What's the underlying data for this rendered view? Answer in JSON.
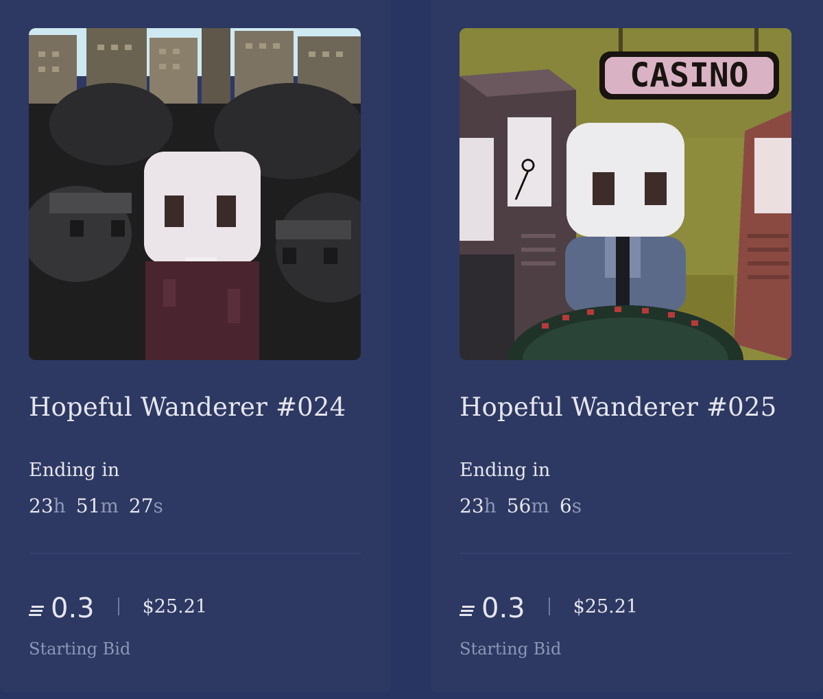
{
  "cards": [
    {
      "title": "Hopeful Wanderer #024",
      "ending_label": "Ending in",
      "countdown": {
        "hours": "23",
        "hours_unit": "h",
        "minutes": "51",
        "minutes_unit": "m",
        "seconds": "27",
        "seconds_unit": "s"
      },
      "price_eth": "0.3",
      "price_usd": "$25.21",
      "price_label": "Starting Bid",
      "icon": "eth-icon"
    },
    {
      "title": "Hopeful Wanderer #025",
      "ending_label": "Ending in",
      "countdown": {
        "hours": "23",
        "hours_unit": "h",
        "minutes": "56",
        "minutes_unit": "m",
        "seconds": "6",
        "seconds_unit": "s"
      },
      "price_eth": "0.3",
      "price_usd": "$25.21",
      "price_label": "Starting Bid",
      "icon": "eth-icon",
      "art_sign": "CASINO"
    }
  ],
  "colors": {
    "page_bg": "#283461",
    "card_bg": "#2d3962",
    "text": "#e6e6ef",
    "muted": "#8e97b8"
  }
}
